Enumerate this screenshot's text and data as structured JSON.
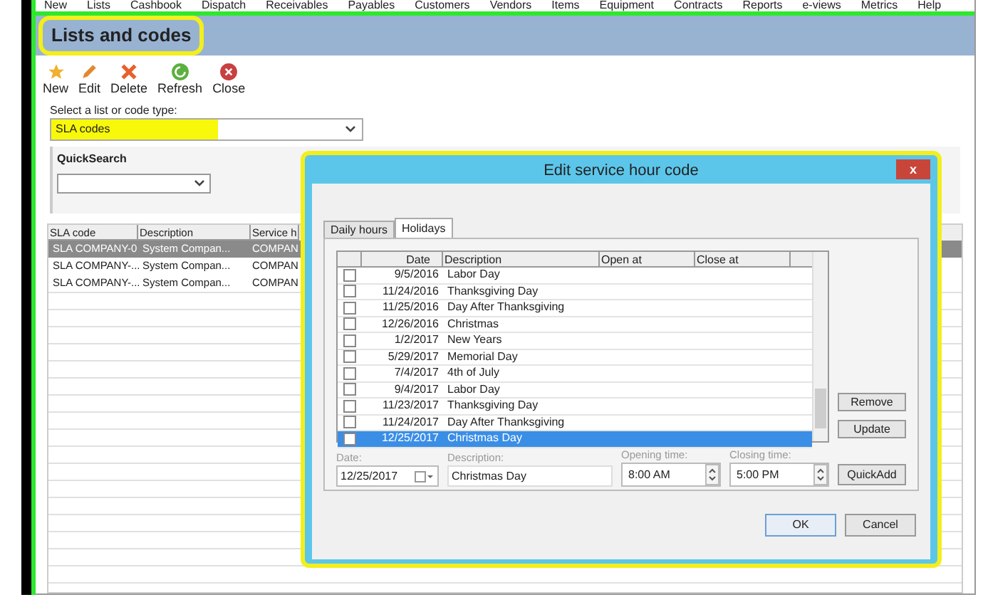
{
  "menu": [
    "New",
    "Lists",
    "Cashbook",
    "Dispatch",
    "Receivables",
    "Payables",
    "Customers",
    "Vendors",
    "Items",
    "Equipment",
    "Contracts",
    "Reports",
    "e-views",
    "Metrics",
    "Help"
  ],
  "title": "Lists and codes",
  "toolbar": [
    {
      "label": "New",
      "kind": "star"
    },
    {
      "label": "Edit",
      "kind": "pencil"
    },
    {
      "label": "Delete",
      "kind": "cross"
    },
    {
      "label": "Refresh",
      "kind": "refresh"
    },
    {
      "label": "Close",
      "kind": "close"
    }
  ],
  "list_select": {
    "label": "Select a list or code type:",
    "value": "SLA codes"
  },
  "quicksearch": {
    "title": "QuickSearch"
  },
  "table": {
    "columns": [
      "SLA code",
      "Description",
      "Service h"
    ],
    "rows": [
      {
        "cells": [
          "SLA COMPANY-0",
          "System Compan...",
          "COMPAN"
        ],
        "selected": true
      },
      {
        "cells": [
          "SLA COMPANY-...",
          "System Compan...",
          "COMPAN"
        ],
        "selected": false
      },
      {
        "cells": [
          "SLA COMPANY-...",
          "System Compan...",
          "COMPAN"
        ],
        "selected": false
      }
    ]
  },
  "dialog": {
    "title": "Edit service hour code",
    "close": "x",
    "tabs": [
      {
        "label": "Daily hours",
        "selected": false
      },
      {
        "label": "Holidays",
        "selected": true
      }
    ],
    "columns": [
      "Date",
      "Description",
      "Open at",
      "Close at"
    ],
    "rows": [
      {
        "date": "9/5/2016",
        "description": "Labor Day",
        "checked": false,
        "selected": false
      },
      {
        "date": "11/24/2016",
        "description": "Thanksgiving Day",
        "checked": false,
        "selected": false
      },
      {
        "date": "11/25/2016",
        "description": "Day After Thanksgiving",
        "checked": false,
        "selected": false
      },
      {
        "date": "12/26/2016",
        "description": "Christmas",
        "checked": false,
        "selected": false
      },
      {
        "date": "1/2/2017",
        "description": "New Years",
        "checked": false,
        "selected": false
      },
      {
        "date": "5/29/2017",
        "description": "Memorial Day",
        "checked": false,
        "selected": false
      },
      {
        "date": "7/4/2017",
        "description": "4th of July",
        "checked": false,
        "selected": false
      },
      {
        "date": "9/4/2017",
        "description": "Labor Day",
        "checked": false,
        "selected": false
      },
      {
        "date": "11/23/2017",
        "description": "Thanksgiving Day",
        "checked": false,
        "selected": false
      },
      {
        "date": "11/24/2017",
        "description": "Day After Thanksgiving",
        "checked": false,
        "selected": false
      },
      {
        "date": "12/25/2017",
        "description": "Christmas Day",
        "checked": false,
        "selected": true
      }
    ],
    "side_buttons": [
      "Remove",
      "Update"
    ],
    "fields": [
      {
        "label": "Date:",
        "value": "12/25/2017",
        "kind": "date"
      },
      {
        "label": "Description:",
        "value": "Christmas Day",
        "kind": "text"
      },
      {
        "label": "Opening time:",
        "value": "8:00 AM",
        "kind": "time"
      },
      {
        "label": "Closing time:",
        "value": "5:00 PM",
        "kind": "time"
      }
    ],
    "quickadd": "QuickAdd",
    "buttons": [
      "OK",
      "Cancel"
    ]
  }
}
